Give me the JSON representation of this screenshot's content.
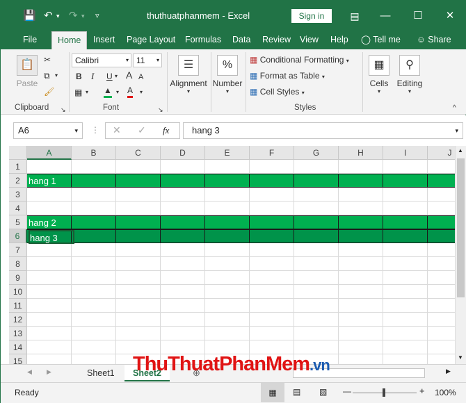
{
  "titlebar": {
    "title": "thuthuatphanmem  -  Excel",
    "signin_label": "Sign in"
  },
  "tabs": [
    {
      "label": "File"
    },
    {
      "label": "Home"
    },
    {
      "label": "Insert"
    },
    {
      "label": "Page Layout"
    },
    {
      "label": "Formulas"
    },
    {
      "label": "Data"
    },
    {
      "label": "Review"
    },
    {
      "label": "View"
    },
    {
      "label": "Help"
    },
    {
      "label": "Tell me"
    },
    {
      "label": "Share"
    }
  ],
  "ribbon": {
    "paste_label": "Paste",
    "clipboard_label": "Clipboard",
    "font_name": "Calibri",
    "font_size": "11",
    "bold": "B",
    "italic": "I",
    "underline": "U",
    "grow_font": "A",
    "shrink_font": "A",
    "font_color_letter": "A",
    "font_label": "Font",
    "alignment_label": "Alignment",
    "number_label": "Number",
    "number_icon": "%",
    "conditional_formatting": "Conditional Formatting",
    "format_as_table": "Format as Table",
    "cell_styles": "Cell Styles",
    "styles_label": "Styles",
    "cells_label": "Cells",
    "editing_label": "Editing"
  },
  "formula_bar": {
    "name_box": "A6",
    "fx": "fx",
    "formula": "hang 3"
  },
  "grid": {
    "columns": [
      "A",
      "B",
      "C",
      "D",
      "E",
      "F",
      "G",
      "H",
      "I",
      "J"
    ],
    "rows": [
      "1",
      "2",
      "3",
      "4",
      "5",
      "6",
      "7",
      "8",
      "9",
      "10",
      "11",
      "12",
      "13",
      "14",
      "15"
    ],
    "cells": {
      "a2": "hang 1",
      "a5": "hang 2",
      "a6": "hang 3"
    },
    "highlight_color": "#00b050",
    "selected_color": "#00934a"
  },
  "sheets": [
    {
      "label": "Sheet1"
    },
    {
      "label": "Sheet2"
    }
  ],
  "status": {
    "ready": "Ready",
    "zoom": "100%"
  },
  "watermark": {
    "text_a": "ThuThuatPhanMem",
    "text_b": ".vn"
  },
  "accent_color": "#217346"
}
